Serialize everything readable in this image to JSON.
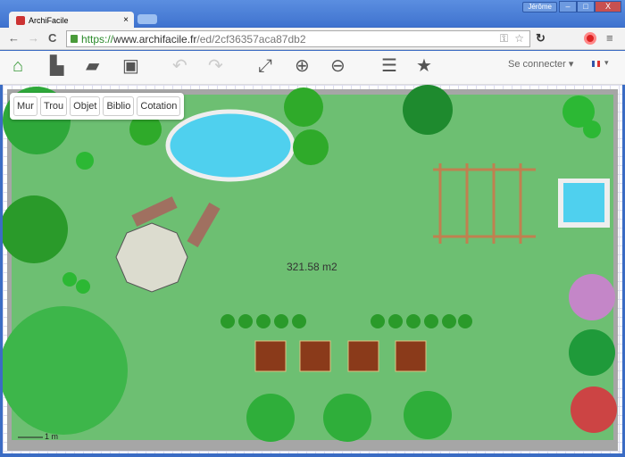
{
  "window": {
    "user": "Jérôme",
    "minimize": "–",
    "maximize": "□",
    "close": "X"
  },
  "tab": {
    "title": "ArchiFacile",
    "close": "×"
  },
  "navbar": {
    "back": "←",
    "forward": "→",
    "reload": "C",
    "url_scheme": "https://",
    "url_host": "www.archifacile.fr",
    "url_path": "/ed/2cf36357aca87db2",
    "menu": "≡"
  },
  "toolbar": {
    "icons": [
      "home-icon",
      "new-file-icon",
      "open-folder-icon",
      "save-icon",
      "undo-icon",
      "redo-icon",
      "fullscreen-icon",
      "zoom-in-icon",
      "zoom-out-icon",
      "list-icon",
      "star-icon"
    ],
    "login": "Se connecter",
    "language": "fr"
  },
  "tools": [
    "Mur",
    "Trou",
    "Objet",
    "Biblio",
    "Cotation"
  ],
  "plan": {
    "area": "321.58 m2",
    "scale": "1 m"
  },
  "colors": {
    "lawn": "#6dbf72",
    "wall": "#a6a6a6",
    "water": "#4fd0ee",
    "home": "#3a9a3a"
  }
}
